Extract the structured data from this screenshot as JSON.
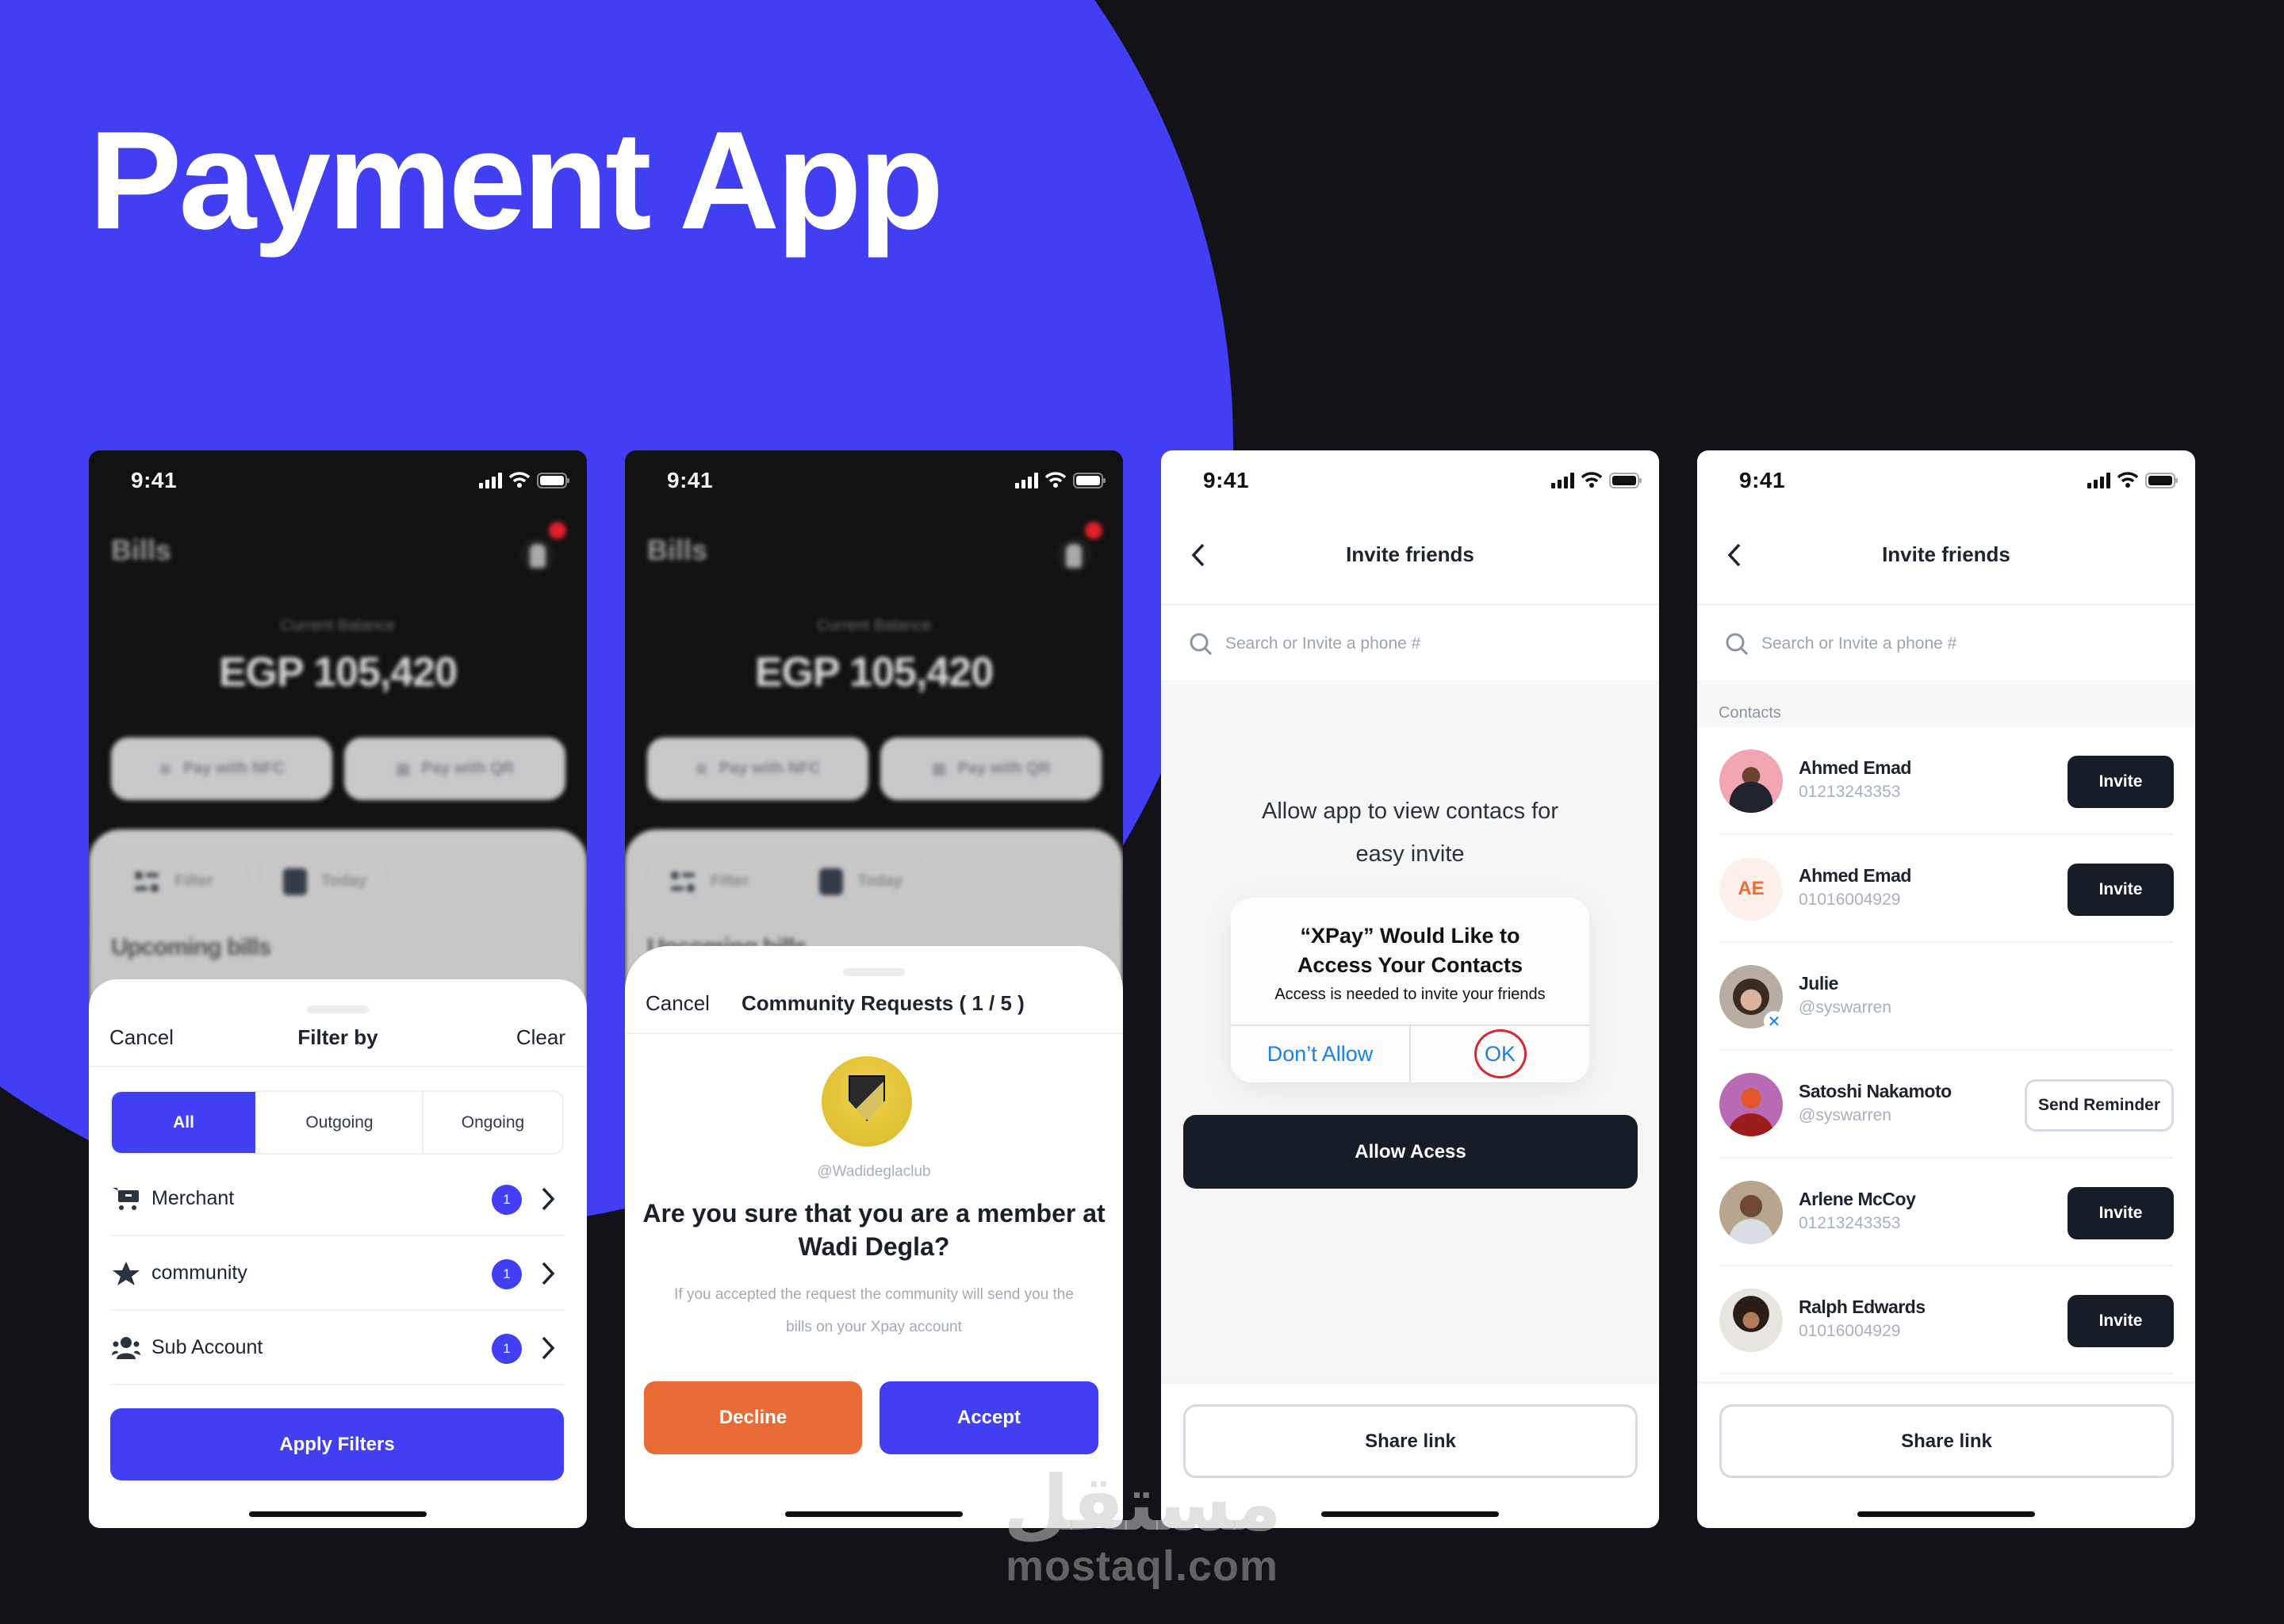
{
  "hero": {
    "title": "Payment App"
  },
  "colors": {
    "brand": "#413ef4",
    "background": "#121218",
    "decline": "#e96b35",
    "dark_button": "#161d26",
    "ios_link": "#1a7ff0",
    "ok_highlight": "#d9262c"
  },
  "status_bar": {
    "time": "9:41",
    "icons": [
      "signal-icon",
      "wifi-icon",
      "battery-icon"
    ]
  },
  "screen1": {
    "background": {
      "title": "Bills",
      "balance_label": "Current Balance",
      "balance_value": "EGP 105,420",
      "pay_nfc": "Pay with NFC",
      "pay_qr": "Pay with QR",
      "chip_filter": "Filter",
      "chip_today": "Today",
      "section": "Upcoming bills"
    },
    "sheet": {
      "cancel": "Cancel",
      "title": "Filter by",
      "clear": "Clear",
      "segments": [
        {
          "label": "All",
          "active": true
        },
        {
          "label": "Outgoing",
          "active": false
        },
        {
          "label": "Ongoing",
          "active": false
        }
      ],
      "rows": [
        {
          "icon": "cart-icon",
          "label": "Merchant",
          "count": "1"
        },
        {
          "icon": "star-icon",
          "label": "community",
          "count": "1"
        },
        {
          "icon": "users-icon",
          "label": "Sub Account",
          "count": "1"
        }
      ],
      "apply": "Apply Filters"
    }
  },
  "screen2": {
    "background": {
      "title": "Bills",
      "balance_label": "Current Balance",
      "balance_value": "EGP 105,420",
      "pay_nfc": "Pay with NFC",
      "pay_qr": "Pay with QR",
      "chip_filter": "Filter",
      "chip_today": "Today",
      "section": "Upcoming bills"
    },
    "sheet": {
      "cancel": "Cancel",
      "title": "Community Requests ( 1 / 5 )",
      "handle": "@Wadideglaclub",
      "question": "Are you sure that you are a member at Wadi Degla?",
      "subtext": "If you accepted the request the community will send you the bills on your Xpay account",
      "decline": "Decline",
      "accept": "Accept"
    }
  },
  "screen3": {
    "nav_title": "Invite friends",
    "search_placeholder": "Search or Invite a phone #",
    "prompt": "Allow app to view contacs for easy invite",
    "dialog": {
      "title": "“XPay” Would Like to Access Your Contacts",
      "message": "Access is needed to invite your friends",
      "deny": "Don’t Allow",
      "ok": "OK"
    },
    "allow_button": "Allow Acess",
    "share_link": "Share link"
  },
  "screen4": {
    "nav_title": "Invite friends",
    "search_placeholder": "Search or Invite a phone #",
    "section_label": "Contacts",
    "contacts": [
      {
        "name": "Ahmed Emad",
        "sub": "01213243353",
        "avatar": "photo",
        "avatar_color": "#f2a5b3",
        "action": "Invite"
      },
      {
        "name": "Ahmed Emad",
        "sub": "01016004929",
        "avatar": "initials",
        "initials": "AE",
        "action": "Invite"
      },
      {
        "name": "Julie",
        "sub": "@syswarren",
        "avatar": "photo",
        "avatar_color": "#8a7260",
        "action": "",
        "badge": "x-badge"
      },
      {
        "name": "Satoshi Nakamoto",
        "sub": "@syswarren",
        "avatar": "photo",
        "avatar_color": "#b86bb4",
        "action": "Send Reminder"
      },
      {
        "name": "Arlene McCoy",
        "sub": "01213243353",
        "avatar": "photo",
        "avatar_color": "#b9a48e",
        "action": "Invite"
      },
      {
        "name": "Ralph Edwards",
        "sub": "01016004929",
        "avatar": "photo",
        "avatar_color": "#e8e4e0",
        "action": "Invite"
      }
    ],
    "share_link": "Share link"
  },
  "watermark": {
    "arabic": "مستقل",
    "latin": "mostaql.com"
  }
}
